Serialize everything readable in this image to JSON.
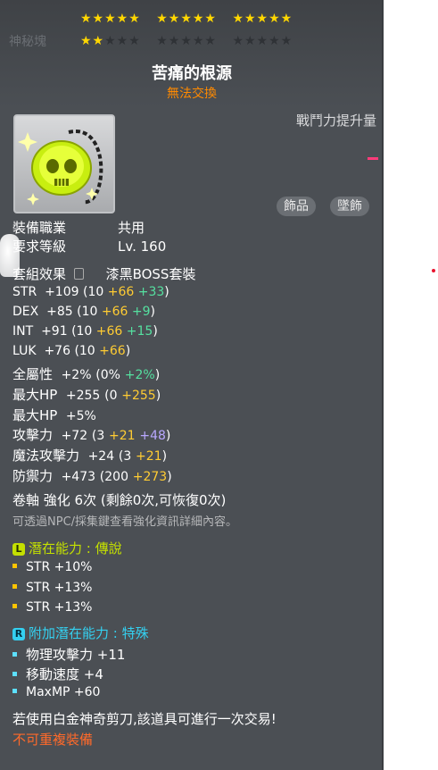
{
  "tooltip": {
    "ghost_text": "神秘塊",
    "stars_row1": [
      "★★★★★",
      "★★★★★",
      "★★★★★"
    ],
    "stars_row2_on": "★★",
    "stars_row2_off": [
      "★★★",
      "★★★★★",
      "★★★★★"
    ],
    "item_name": "苦痛的根源",
    "trade_status": "無法交換",
    "combat_power_label": "戰鬥力提升量",
    "tags": [
      "飾品",
      "墜飾"
    ],
    "job_label": "裝備職業",
    "job_value": "共用",
    "level_label": "要求等級",
    "level_value": "Lv. 160",
    "set_label": "套組效果",
    "set_value": "漆黑BOSS套裝",
    "stats": {
      "str": {
        "label": "STR",
        "total": "+109",
        "base": "(10",
        "bonus1": "+66",
        "bonus2": "+33",
        "close": ")"
      },
      "dex": {
        "label": "DEX",
        "total": "+85",
        "base": "(10",
        "bonus1": "+66",
        "bonus2": "+9",
        "close": ")"
      },
      "int": {
        "label": "INT",
        "total": "+91",
        "base": "(10",
        "bonus1": "+66",
        "bonus2": "+15",
        "close": ")"
      },
      "luk": {
        "label": "LUK",
        "total": "+76",
        "base": "(10",
        "bonus1": "+66",
        "close": ")"
      },
      "all": {
        "label": "全屬性",
        "total": "+2%",
        "base": "(0%",
        "bonus2": "+2%",
        "close": ")"
      },
      "hp": {
        "label": "最大HP",
        "total": "+255",
        "base": "(0",
        "bonus1": "+255",
        "close": ")"
      },
      "hp_pct": {
        "label": "最大HP",
        "total": "+5%"
      },
      "atk": {
        "label": "攻擊力",
        "total": "+72",
        "base": "(3",
        "bonus1": "+21",
        "bonus3": "+48",
        "close": ")"
      },
      "matk": {
        "label": "魔法攻擊力",
        "total": "+24",
        "base": "(3",
        "bonus1": "+21",
        "close": ")"
      },
      "def": {
        "label": "防禦力",
        "total": "+473",
        "base": "(200",
        "bonus1": "+273",
        "close": ")"
      }
    },
    "scroll_text": "卷軸 強化 6次 (剩餘0次,可恢復0次)",
    "hint_text": "可透過NPC/採集鍵查看強化資訊詳細內容。",
    "potential": {
      "badge": "L",
      "title": "潛在能力 : 傳說",
      "lines": [
        "STR +10%",
        "STR +13%",
        "STR +13%"
      ]
    },
    "additional": {
      "badge": "R",
      "title": "附加潛在能力 : 特殊",
      "lines": [
        "物理攻擊力 +11",
        "移動速度 +4",
        "MaxMP +60"
      ]
    },
    "scissors_text": "若使用白金神奇剪刀,該道具可進行一次交易!",
    "unique_text": "不可重複裝備"
  },
  "colors": {
    "panel_bg": "#4b4f54",
    "star_on": "#ffd700",
    "trade_orange": "#ff8a00",
    "bonus_yellow": "#ffcc33",
    "bonus_green": "#55e0a0",
    "bonus_purple": "#b9a8ff",
    "unique_red": "#ff6a2a"
  },
  "icons": [
    "skull-pendant-icon",
    "lock-icon",
    "legendary-badge-icon",
    "rare-badge-icon",
    "hand-cursor-icon"
  ]
}
